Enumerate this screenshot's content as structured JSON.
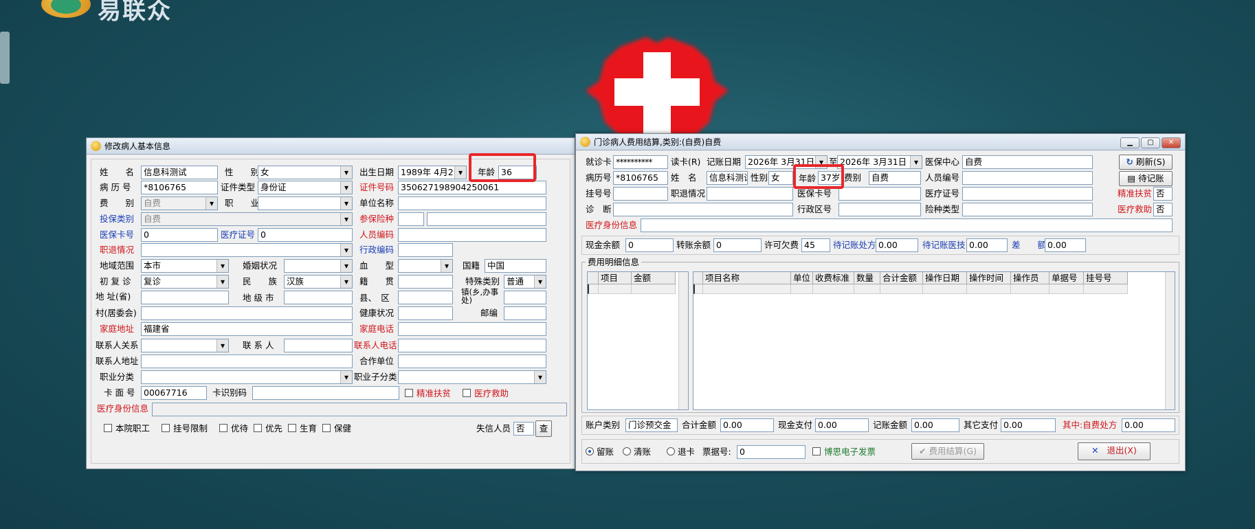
{
  "background": {
    "brand_text": "易联众"
  },
  "left_dialog": {
    "title": "修改病人基本信息",
    "labels": {
      "name": "姓　　名",
      "gender": "性　　别",
      "birth_date": "出生日期",
      "age": "年龄",
      "record_no": "病 历 号",
      "id_type": "证件类型",
      "id_no": "证件号码",
      "fee_type": "费　　别",
      "occupation": "职　　业",
      "employer": "单位名称",
      "insured_type": "投保类别",
      "insured_risk": "参保险种",
      "insurance_card": "医保卡号",
      "medical_cert": "医疗证号",
      "staff_code": "人员编码",
      "retirement": "职退情况",
      "admin_code": "行政编码",
      "region": "地域范围",
      "marital": "婚姻状况",
      "blood": "血　　型",
      "nationality": "国籍",
      "visit": "初 复 诊",
      "ethnicity": "民　　族",
      "native_place": "籍　　贯",
      "special": "特殊类别",
      "province": "地 址(省)",
      "city": "地 级 市",
      "county": "县、　区",
      "town": "镇(乡,办事处)",
      "village": "村(居委会)",
      "health": "健康状况",
      "postcode": "邮编",
      "home_address": "家庭地址",
      "home_phone": "家庭电话",
      "contact_relation": "联系人关系",
      "contact": "联 系 人",
      "contact_phone": "联系人电话",
      "contact_address": "联系人地址",
      "coop_unit": "合作单位",
      "occ_class": "职业分类",
      "occ_subclass": "职业子分类",
      "card_no": "卡 面 号",
      "card_id": "卡识别码",
      "precise_aid": "精准扶贫",
      "medical_aid": "医疗救助",
      "identity_info": "医疗身份信息",
      "dishonest": "失信人员"
    },
    "values": {
      "name": "信息科测试",
      "gender": "女",
      "birth_date": "1989年 4月2",
      "age": "36",
      "record_no": "*8106765",
      "id_type": "身份证",
      "id_no": "350627198904250061",
      "fee_type": "自费",
      "insured_type": "自费",
      "insurance_card": "0",
      "medical_cert": "0",
      "region": "本市",
      "nationality": "中国",
      "visit": "复诊",
      "ethnicity": "汉族",
      "special": "普通",
      "home_address": "福建省",
      "card_no": "00067716",
      "dishonest": "否"
    },
    "checkboxes": [
      "本院职工",
      "挂号限制",
      "优待",
      "优先",
      "生育",
      "保健"
    ],
    "query_button": "查"
  },
  "right_dialog": {
    "title": "门诊病人费用结算,类别:(自费)自费",
    "labels": {
      "visit_card": "就诊卡",
      "read_card": "读卡(R)",
      "account_date": "记账日期",
      "to": "至",
      "insurance_center": "医保中心",
      "record_no": "病历号",
      "name": "姓　名",
      "gender": "性别",
      "age": "年龄",
      "fee_type": "费别",
      "person_code": "人员编号",
      "reg_no": "挂号号",
      "retirement": "职退情况",
      "insurance_card": "医保卡号",
      "medical_cert": "医疗证号",
      "precise_aid": "精准扶贫",
      "diagnosis": "诊　断",
      "admin_area": "行政区号",
      "risk_type": "险种类型",
      "medical_aid": "医疗救助",
      "identity_info": "医疗身份信息",
      "cash_balance": "现金余额",
      "transfer_balance": "转账余额",
      "allowed_arrears": "许可欠费",
      "pending_rx": "待记账处方",
      "pending_tech": "待记账医技",
      "difference": "差　　额",
      "detail_group": "费用明细信息",
      "account_type": "账户类别",
      "total": "合计金额",
      "cash_pay": "现金支付",
      "credit_amount": "记账金额",
      "other_pay": "其它支付",
      "self_rx": "其中:自费处方",
      "receipt_no": "票据号:"
    },
    "values": {
      "visit_card": "**********",
      "date_from": "2026年 3月31日",
      "date_to": "2026年 3月31日",
      "insurance_center": "自费",
      "record_no": "*8106765",
      "name": "信息科测试",
      "gender": "女",
      "age": "37岁",
      "fee_type": "自费",
      "precise_aid": "否",
      "medical_aid": "否",
      "cash_balance": "0",
      "transfer_balance": "0",
      "allowed_arrears": "45",
      "pending_rx": "0.00",
      "pending_tech": "0.00",
      "difference": "0.00",
      "account_type": "门诊预交金",
      "total": "0.00",
      "cash_pay": "0.00",
      "credit_amount": "0.00",
      "other_pay": "0.00",
      "self_rx": "0.00",
      "receipt_no": "0"
    },
    "left_table_headers": [
      "项目",
      "金额"
    ],
    "right_table_headers": [
      "项目名称",
      "单位",
      "收费标准",
      "数量",
      "合计金额",
      "操作日期",
      "操作时间",
      "操作员",
      "单据号",
      "挂号号"
    ],
    "buttons": {
      "refresh": "刷新(S)",
      "pending": "待记账",
      "settle": "费用结算(G)",
      "exit": "退出(X)"
    },
    "radios": [
      "留账",
      "清账",
      "退卡"
    ],
    "einvoice": "博思电子发票"
  },
  "colors": {
    "highlight": "#e8272a",
    "red_label": "#d0161b",
    "blue_label": "#1a3fb5"
  }
}
